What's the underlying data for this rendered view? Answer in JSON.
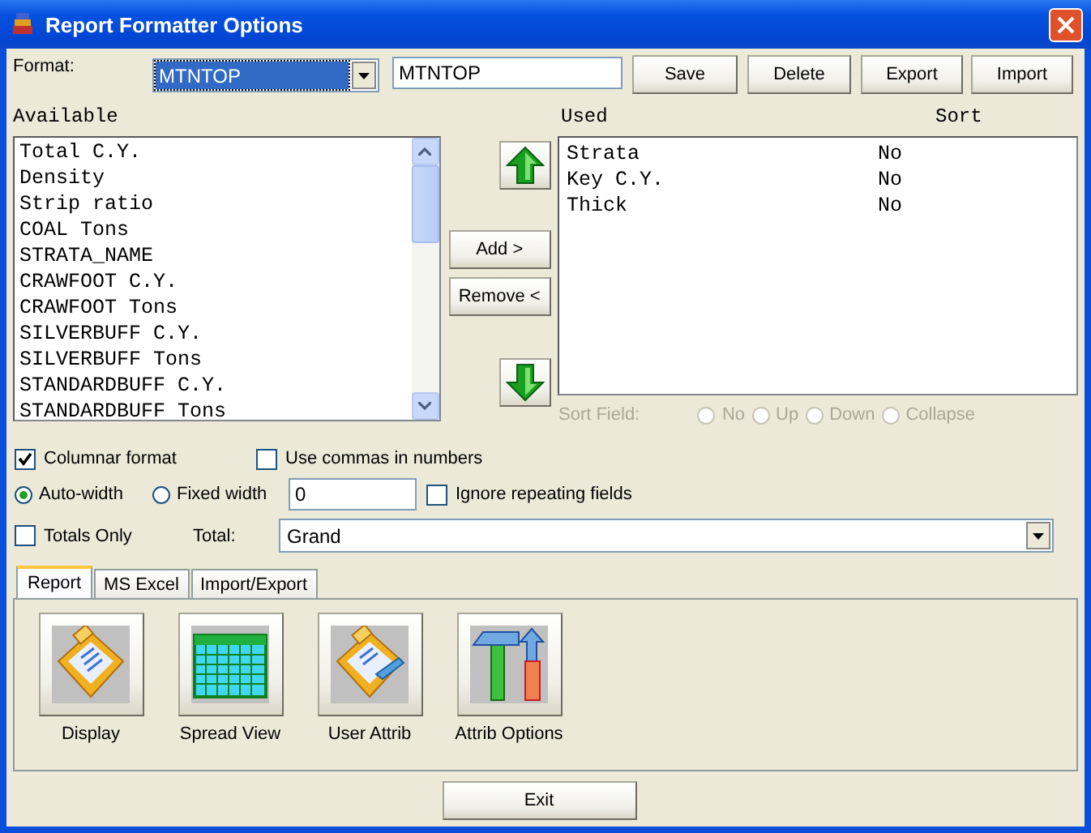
{
  "window": {
    "title": "Report Formatter Options"
  },
  "format": {
    "label": "Format:",
    "selected": "MTNTOP",
    "name": "MTNTOP"
  },
  "toolbar_buttons": [
    "Save",
    "Delete",
    "Export",
    "Import"
  ],
  "available": {
    "label": "Available",
    "items": [
      "Total C.Y.",
      "Density",
      "Strip ratio",
      "COAL Tons",
      "STRATA_NAME",
      "CRAWFOOT C.Y.",
      "CRAWFOOT Tons",
      "SILVERBUFF C.Y.",
      "SILVERBUFF Tons",
      "STANDARDBUFF C.Y.",
      "STANDARDBUFF Tons"
    ]
  },
  "move_buttons": [
    "Add >",
    "Remove <"
  ],
  "used": {
    "label": "Used",
    "sort_label": "Sort",
    "rows": [
      {
        "name": "Strata",
        "sort": "No"
      },
      {
        "name": "Key C.Y.",
        "sort": "No"
      },
      {
        "name": "Thick",
        "sort": "No"
      }
    ]
  },
  "sort_field": {
    "label": "Sort Field:",
    "disabled": true,
    "options": [
      {
        "label": "No",
        "selected": false
      },
      {
        "label": "Up",
        "selected": false
      },
      {
        "label": "Down",
        "selected": false
      },
      {
        "label": "Collapse",
        "selected": false
      }
    ]
  },
  "columnar": {
    "label": "Columnar format",
    "checked": true
  },
  "commas": {
    "label": "Use commas in numbers",
    "checked": false
  },
  "width_mode": [
    {
      "label": "Auto-width",
      "selected": true
    },
    {
      "label": "Fixed width",
      "selected": false
    }
  ],
  "fixed_width_value": "0",
  "ignore_repeating": {
    "label": "Ignore repeating fields",
    "checked": false
  },
  "totals_only": {
    "label": "Totals Only",
    "checked": false
  },
  "total": {
    "label": "Total:",
    "value": "Grand"
  },
  "tabs": [
    {
      "label": "Report",
      "selected": true
    },
    {
      "label": "MS Excel",
      "selected": false
    },
    {
      "label": "Import/Export",
      "selected": false
    }
  ],
  "tools": [
    {
      "label": "Display",
      "kind": "display"
    },
    {
      "label": "Spread View",
      "kind": "spread"
    },
    {
      "label": "User Attrib",
      "kind": "user"
    },
    {
      "label": "Attrib Options",
      "kind": "tools"
    }
  ],
  "exit_button": "Exit"
}
